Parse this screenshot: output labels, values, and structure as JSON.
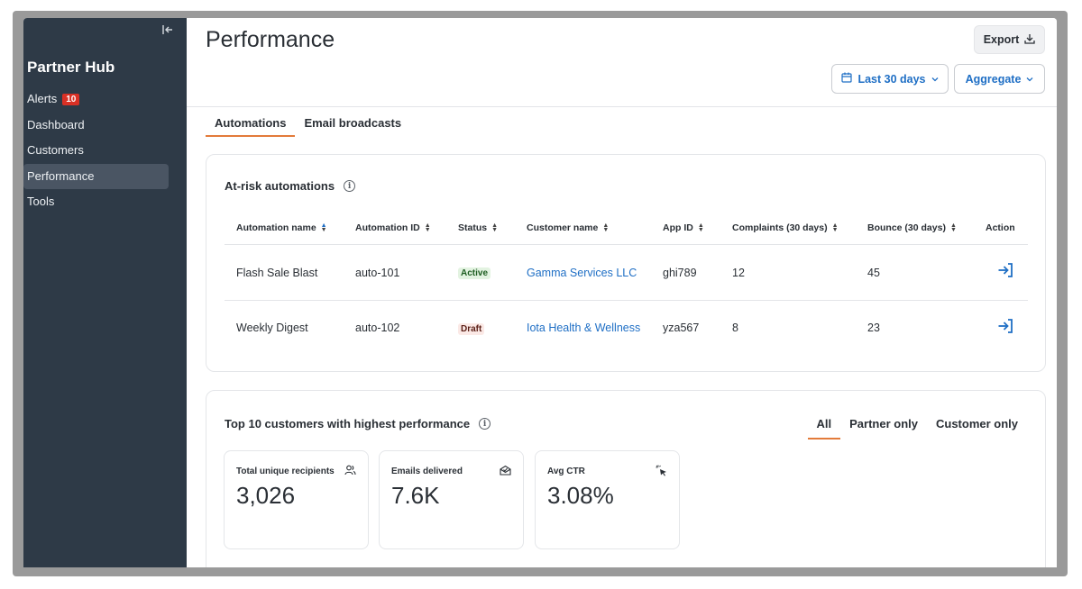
{
  "sidebar": {
    "brand": "Partner Hub",
    "items": [
      {
        "label": "Alerts",
        "badge": "10"
      },
      {
        "label": "Dashboard"
      },
      {
        "label": "Customers"
      },
      {
        "label": "Performance",
        "active": true
      },
      {
        "label": "Tools"
      }
    ]
  },
  "header": {
    "title": "Performance",
    "export_label": "Export",
    "date_range_label": "Last 30 days",
    "aggregate_label": "Aggregate"
  },
  "tabs": [
    {
      "label": "Automations",
      "active": true
    },
    {
      "label": "Email broadcasts"
    }
  ],
  "at_risk": {
    "title": "At-risk automations",
    "columns": [
      "Automation name",
      "Automation ID",
      "Status",
      "Customer name",
      "App ID",
      "Complaints (30 days)",
      "Bounce (30 days)",
      "Action"
    ],
    "rows": [
      {
        "name": "Flash Sale Blast",
        "id": "auto-101",
        "status": "Active",
        "customer": "Gamma Services LLC",
        "app_id": "ghi789",
        "complaints": "12",
        "bounce": "45"
      },
      {
        "name": "Weekly Digest",
        "id": "auto-102",
        "status": "Draft",
        "customer": "Iota Health & Wellness",
        "app_id": "yza567",
        "complaints": "8",
        "bounce": "23"
      }
    ]
  },
  "top_customers": {
    "title": "Top 10 customers with highest performance",
    "filters": [
      "All",
      "Partner only",
      "Customer only"
    ],
    "stats": [
      {
        "label": "Total unique recipients",
        "value": "3,026",
        "icon": "users-icon"
      },
      {
        "label": "Emails delivered",
        "value": "7.6K",
        "icon": "envelope-open-icon"
      },
      {
        "label": "Avg CTR",
        "value": "3.08%",
        "icon": "click-cursor-icon"
      }
    ]
  },
  "colors": {
    "sidebar_bg": "#2e3a47",
    "accent_blue": "#1f6fc5",
    "tab_underline": "#e37b3a",
    "alert_badge": "#d93025"
  }
}
